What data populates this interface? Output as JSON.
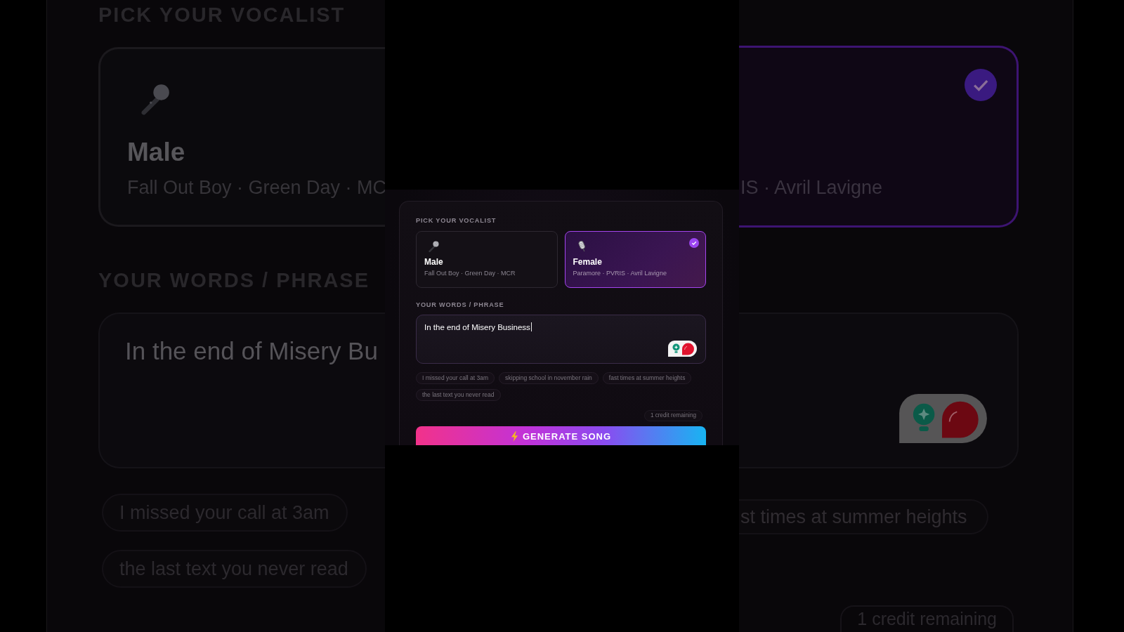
{
  "backdrop": {
    "left": {
      "vocalist_label": "PICK YOUR VOCALIST",
      "vocalist": {
        "name": "Male",
        "artists": "Fall Out Boy · Green Day · MC",
        "selected": false
      },
      "words_label": "YOUR WORDS / PHRASE",
      "phrase": "In the end of Misery Bu",
      "suggestions": [
        "I missed your call at 3am",
        "the last text you never read"
      ]
    },
    "right": {
      "vocalist": {
        "artists": "IS · Avril Lavigne",
        "selected": true
      },
      "suggestions": [
        "st times at summer heights"
      ],
      "credits": "1 credit remaining"
    }
  },
  "form": {
    "vocalist_label": "PICK YOUR VOCALIST",
    "vocalists": [
      {
        "name": "Male",
        "artists": "Fall Out Boy · Green Day · MCR",
        "selected": false
      },
      {
        "name": "Female",
        "artists": "Paramore · PVRIS · Avril Lavigne",
        "selected": true
      }
    ],
    "words_label": "YOUR WORDS / PHRASE",
    "phrase": {
      "value": "In the end of Misery Business",
      "focused": true
    },
    "suggestions": [
      "I missed your call at 3am",
      "skipping school in november rain",
      "fast times at summer heights",
      "the last text you never read"
    ],
    "credits": "1 credit remaining",
    "generate_button": "GENERATE SONG"
  }
}
